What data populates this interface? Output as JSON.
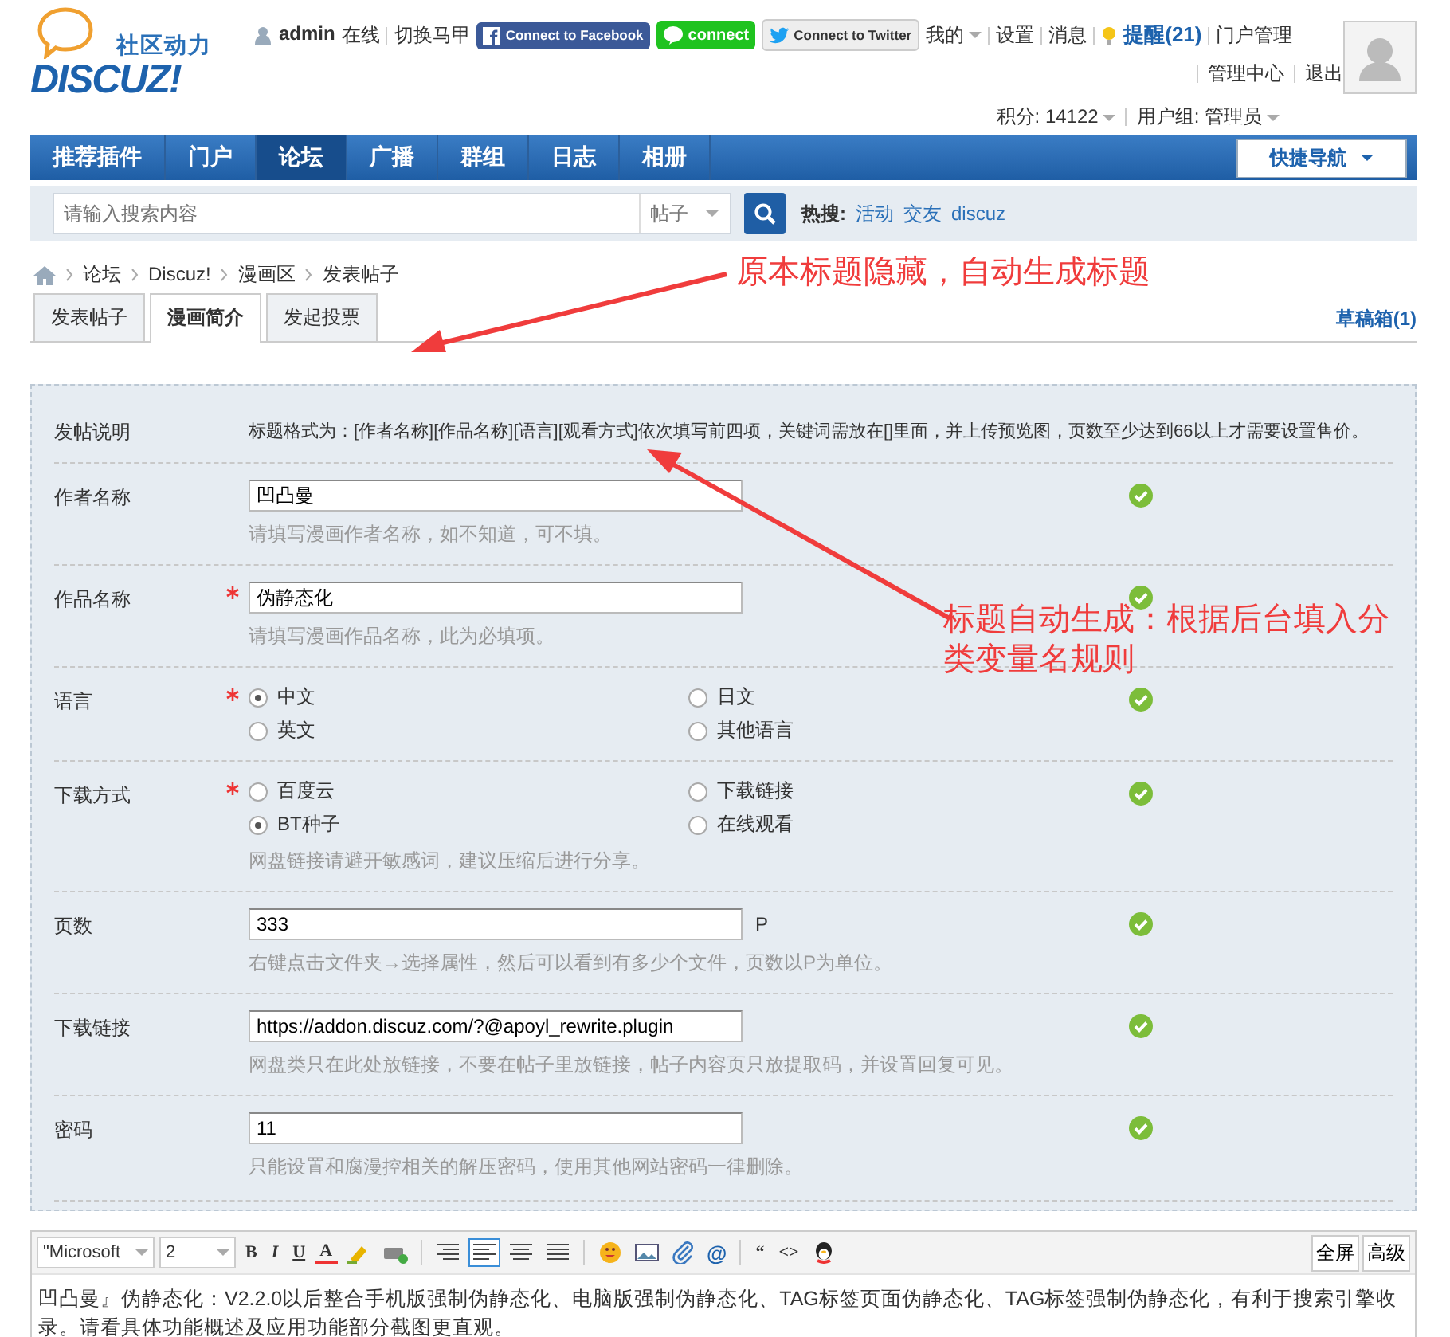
{
  "header": {
    "logo": {
      "slogan": "社区动力",
      "wordmark": "DISCUZ!"
    },
    "user": {
      "name": "admin",
      "status": "在线"
    },
    "switch_link": "切换马甲",
    "connect_buttons": [
      {
        "kind": "facebook",
        "label": "Connect to Facebook"
      },
      {
        "kind": "line",
        "label": "connect"
      },
      {
        "kind": "twitter",
        "label": "Connect to Twitter"
      }
    ],
    "menu": [
      {
        "label": "我的",
        "dropdown": true
      },
      {
        "label": "设置",
        "dropdown": false
      },
      {
        "label": "消息",
        "dropdown": false
      },
      {
        "label": "提醒(21)",
        "dropdown": false,
        "kind": "alert"
      },
      {
        "label": "门户管理",
        "dropdown": false
      }
    ],
    "menu_line2": [
      "管理中心",
      "退出"
    ],
    "credits": "积分: 14122",
    "group": "用户组: 管理员"
  },
  "nav": {
    "items": [
      {
        "label": "推荐插件",
        "selected": false
      },
      {
        "label": "门户",
        "selected": false
      },
      {
        "label": "论坛",
        "selected": true
      },
      {
        "label": "广播",
        "selected": false
      },
      {
        "label": "群组",
        "selected": false
      },
      {
        "label": "日志",
        "selected": false
      },
      {
        "label": "相册",
        "selected": false
      }
    ],
    "quick_nav": "快捷导航"
  },
  "search": {
    "placeholder": "请输入搜索内容",
    "type": "帖子",
    "hot_label": "热搜:",
    "hot": [
      "活动",
      "交友",
      "discuz"
    ]
  },
  "breadcrumb": [
    "论坛",
    "Discuz!",
    "漫画区",
    "发表帖子"
  ],
  "tabs": [
    {
      "label": "发表帖子",
      "selected": false
    },
    {
      "label": "漫画简介",
      "selected": true
    },
    {
      "label": "发起投票",
      "selected": false
    }
  ],
  "drafts": "草稿箱(1)",
  "form": {
    "rows": [
      {
        "kind": "note",
        "label": "发帖说明",
        "text": "标题格式为：[作者名称][作品名称][语言][观看方式]依次填写前四项，关键词需放在[]里面，并上传预览图，页数至少达到66以上才需要设置售价。"
      },
      {
        "kind": "text",
        "label": "作者名称",
        "required": false,
        "value": "凹凸曼",
        "hint": "请填写漫画作者名称，如不知道，可不填。",
        "valid": true
      },
      {
        "kind": "text",
        "label": "作品名称",
        "required": true,
        "value": "伪静态化",
        "hint": "请填写漫画作品名称，此为必填项。",
        "valid": true
      },
      {
        "kind": "radio",
        "label": "语言",
        "required": true,
        "options": [
          {
            "label": "中文",
            "selected": true
          },
          {
            "label": "日文",
            "selected": false
          },
          {
            "label": "英文",
            "selected": false
          },
          {
            "label": "其他语言",
            "selected": false
          }
        ],
        "valid": true
      },
      {
        "kind": "radio",
        "label": "下载方式",
        "required": true,
        "options": [
          {
            "label": "百度云",
            "selected": false
          },
          {
            "label": "下载链接",
            "selected": false
          },
          {
            "label": "BT种子",
            "selected": true
          },
          {
            "label": "在线观看",
            "selected": false
          }
        ],
        "hint": "网盘链接请避开敏感词，建议压缩后进行分享。",
        "valid": true
      },
      {
        "kind": "text",
        "label": "页数",
        "required": false,
        "value": "333",
        "unit": "P",
        "hint": "右键点击文件夹→选择属性，然后可以看到有多少个文件，页数以P为单位。",
        "valid": true
      },
      {
        "kind": "text",
        "label": "下载链接",
        "required": false,
        "value": "https://addon.discuz.com/?@apoyl_rewrite.plugin",
        "hint": "网盘类只在此处放链接，不要在帖子里放链接，帖子内容页只放提取码，并设置回复可见。",
        "valid": true
      },
      {
        "kind": "text",
        "label": "密码",
        "required": false,
        "value": "11",
        "hint": "只能设置和腐漫控相关的解压密码，使用其他网站密码一律删除。",
        "valid": true
      }
    ]
  },
  "editor": {
    "font": "\"Microsoft",
    "size": "2",
    "glyphs": [
      "B",
      "I",
      "U",
      "A"
    ],
    "mention": "@",
    "quote_glyphs": [
      "“",
      "<>"
    ],
    "right_buttons": [
      "全屏",
      "高级"
    ],
    "content": "凹凸曼』伪静态化：V2.2.0以后整合手机版强制伪静态化、电脑版强制伪静态化、TAG标签页面伪静态化、TAG标签强制伪静态化，有利于搜索引擎收录。请看具体功能概述及应用功能部分截图更直观。"
  },
  "annotations": [
    "原本标题隐藏，自动生成标题",
    "标题自动生成：根据后台填入分类变量名规则"
  ]
}
